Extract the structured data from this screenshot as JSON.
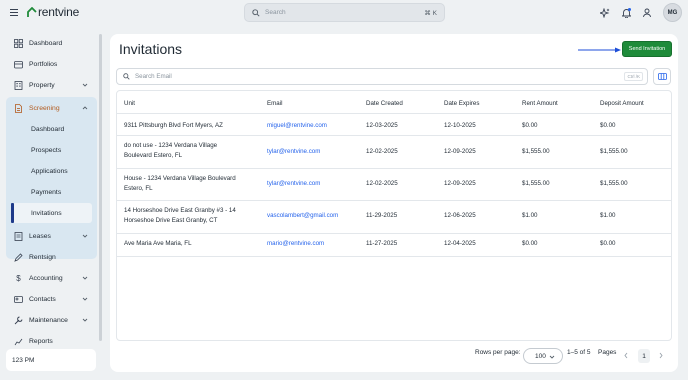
{
  "app": {
    "logo_text": "rentvine"
  },
  "topbar": {
    "search_placeholder": "Search",
    "search_shortcut": "⌘ K",
    "avatar_initials": "MG"
  },
  "sidebar": {
    "dashboard": "Dashboard",
    "portfolios": "Portfolios",
    "property": "Property",
    "screening": "Screening",
    "screening_items": [
      "Dashboard",
      "Prospects",
      "Applications",
      "Payments",
      "Invitations"
    ],
    "leases": "Leases",
    "rentsign": "Rentsign",
    "accounting": "Accounting",
    "contacts": "Contacts",
    "maintenance": "Maintenance",
    "reports": "Reports",
    "time": "123 PM"
  },
  "main": {
    "title": "Invitations",
    "send_button": "Send Invitation",
    "search_placeholder": "Search Email",
    "search_shortcut": "Ctrl /K",
    "columns": [
      "Unit",
      "Email",
      "Date Created",
      "Date Expires",
      "Rent Amount",
      "Deposit Amount"
    ],
    "rows": [
      {
        "unit1": "9311 Pittsburgh Blvd Fort Myers, AZ",
        "unit2": "",
        "email": "miguel@rentvine.com",
        "created": "12-03-2025",
        "expires": "12-10-2025",
        "rent": "$0.00",
        "deposit": "$0.00"
      },
      {
        "unit1": "do not use - 1234 Verdana Village",
        "unit2": "Boulevard Estero, FL",
        "email": "tylar@rentvine.com",
        "created": "12-02-2025",
        "expires": "12-09-2025",
        "rent": "$1,555.00",
        "deposit": "$1,555.00"
      },
      {
        "unit1": "House - 1234 Verdana Village Boulevard",
        "unit2": "Estero, FL",
        "email": "tylar@rentvine.com",
        "created": "12-02-2025",
        "expires": "12-09-2025",
        "rent": "$1,555.00",
        "deposit": "$1,555.00"
      },
      {
        "unit1": "14 Horseshoe Drive East Granby #3 - 14",
        "unit2": "Horseshoe Drive East Granby, CT",
        "email": "vascolambert@gmail.com",
        "created": "11-29-2025",
        "expires": "12-06-2025",
        "rent": "$1.00",
        "deposit": "$1.00"
      },
      {
        "unit1": "Ave Maria Ave Maria, FL",
        "unit2": "",
        "email": "mario@rentvine.com",
        "created": "11-27-2025",
        "expires": "12-04-2025",
        "rent": "$0.00",
        "deposit": "$0.00"
      }
    ],
    "rows_per_page_label": "Rows per page:",
    "rows_per_page": "100",
    "range": "1–5 of 5",
    "pages_label": "Pages",
    "current_page": "1"
  },
  "colors": {
    "accent": "#1f8b3a",
    "link": "#2563eb",
    "nav_active": "#d9e7f1",
    "arrow": "#1d4ed8"
  }
}
